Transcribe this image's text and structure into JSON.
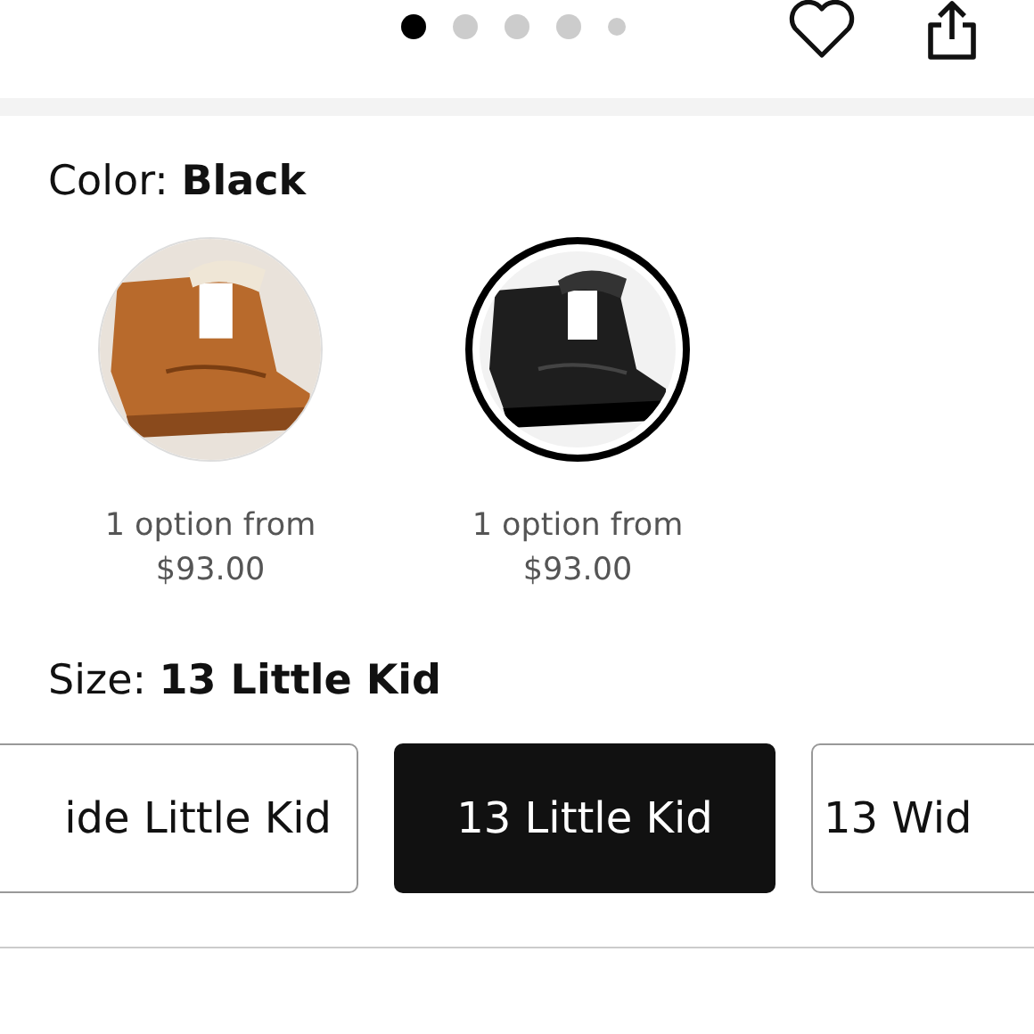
{
  "carousel_dots": [
    {
      "selected": true,
      "kind": "full"
    },
    {
      "selected": false,
      "kind": "full"
    },
    {
      "selected": false,
      "kind": "full"
    },
    {
      "selected": false,
      "kind": "full"
    },
    {
      "selected": false,
      "kind": "small"
    }
  ],
  "color": {
    "label": "Color: **Black**",
    "swatches": [
      {
        "kind": "picture",
        "selected": false,
        "caption_line_1": "1 option from",
        "caption_line_2": "$93.00"
      },
      {
        "kind": "picture",
        "selected": true,
        "caption_line_1": "1 option from",
        "caption_line_2": "$93.00"
      }
    ]
  },
  "size": {
    "label": "Size: **13 Little Kid**",
    "options": [
      {
        "label": "ide Little Kid",
        "selected": false,
        "kind": "cut_left"
      },
      {
        "label": "13 Little Kid",
        "selected": true,
        "kind": "whole"
      },
      {
        "label": "13 Wid",
        "selected": false,
        "kind": "cut_right"
      }
    ]
  }
}
